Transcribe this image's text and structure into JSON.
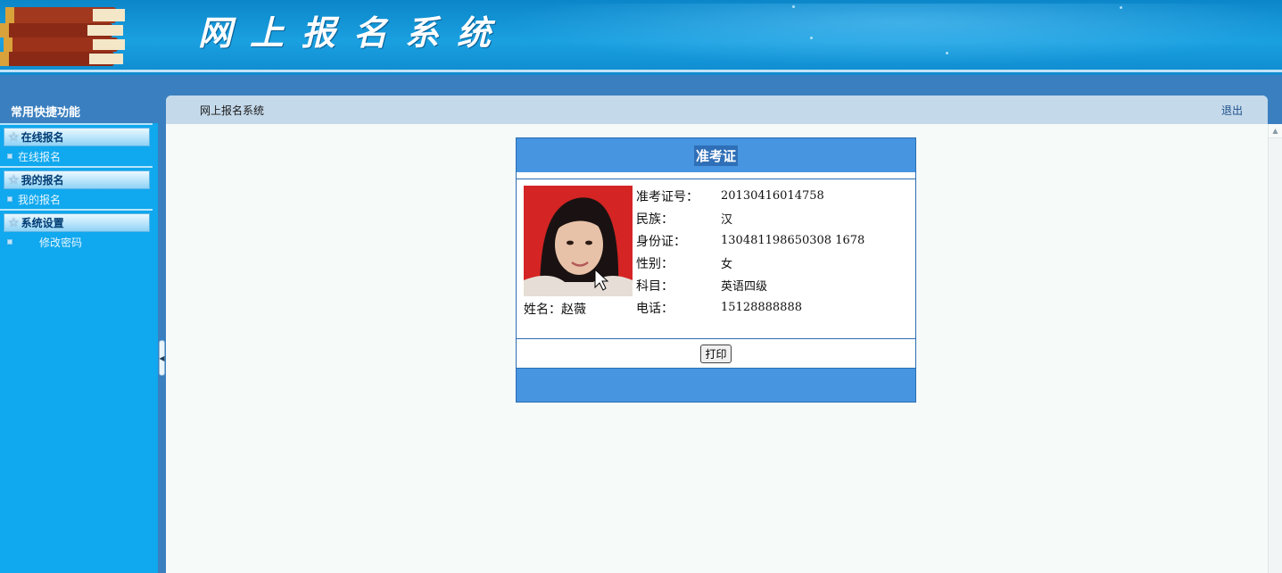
{
  "header": {
    "app_title": "网上报名系统",
    "books_icon": "books-icon"
  },
  "sidebar": {
    "title": "常用快捷功能",
    "groups": [
      {
        "title": "在线报名",
        "icon": "star-icon",
        "items": [
          {
            "label": "在线报名"
          }
        ]
      },
      {
        "title": "我的报名",
        "icon": "star-icon",
        "items": [
          {
            "label": "我的报名"
          }
        ]
      },
      {
        "title": "系统设置",
        "icon": "star-icon",
        "items": [
          {
            "label": "修改密码"
          }
        ]
      }
    ]
  },
  "main": {
    "breadcrumb": "网上报名系统",
    "logout_label": "退出"
  },
  "ticket": {
    "title": "准考证",
    "name_label": "姓名：",
    "name_value": "赵薇",
    "fields": [
      {
        "label": "准考证号：",
        "value": "20130416014758"
      },
      {
        "label": "民族：",
        "value": "汉"
      },
      {
        "label": "身份证：",
        "value": "130481198650308 1678"
      },
      {
        "label": "性别：",
        "value": "女"
      },
      {
        "label": "科目：",
        "value": "英语四级"
      },
      {
        "label": "电话：",
        "value": "15128888888"
      }
    ],
    "print_label": "打印"
  },
  "colors": {
    "banner_blue": "#1aa0e0",
    "sidebar_blue": "#10a8ee",
    "ticket_blue": "#4795e0",
    "photo_red": "#d42424"
  }
}
